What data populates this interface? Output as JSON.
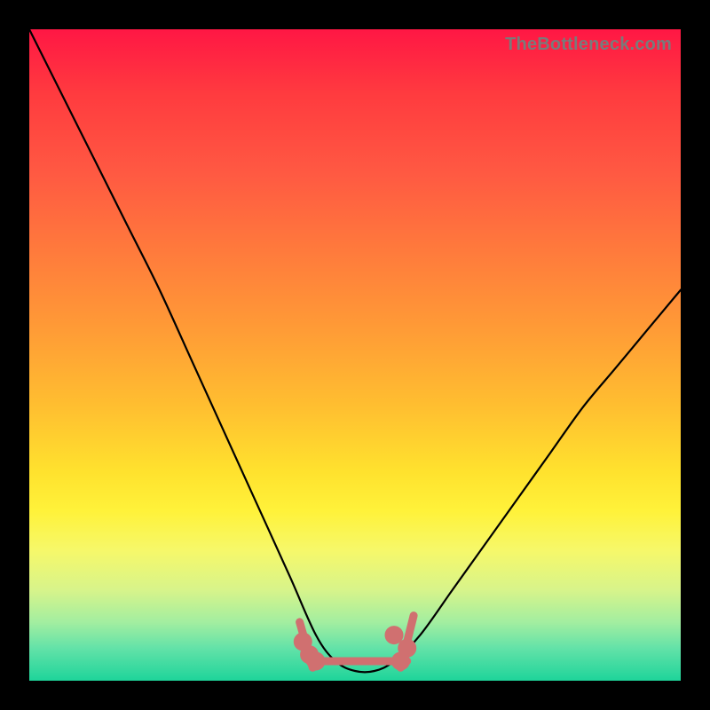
{
  "watermark": "TheBottleneck.com",
  "colors": {
    "frame": "#000000",
    "curve": "#000000",
    "bump": "#d07070",
    "gradient_top": "#ff1744",
    "gradient_bottom": "#1ed49a"
  },
  "chart_data": {
    "type": "line",
    "title": "",
    "xlabel": "",
    "ylabel": "",
    "xlim": [
      0,
      100
    ],
    "ylim": [
      0,
      100
    ],
    "grid": false,
    "legend": false,
    "series": [
      {
        "name": "bottleneck-curve",
        "x": [
          0,
          5,
          10,
          15,
          20,
          25,
          30,
          35,
          40,
          44,
          47,
          50,
          53,
          56,
          60,
          65,
          70,
          75,
          80,
          85,
          90,
          95,
          100
        ],
        "y": [
          100,
          90,
          80,
          70,
          60,
          49,
          38,
          27,
          16,
          7,
          3,
          1.5,
          1.5,
          3,
          7,
          14,
          21,
          28,
          35,
          42,
          48,
          54,
          60
        ]
      }
    ],
    "annotations": [
      {
        "name": "sweet-spot-cluster",
        "shape": "blob",
        "x_range": [
          43,
          58
        ],
        "y_range": [
          1,
          7
        ]
      }
    ]
  }
}
